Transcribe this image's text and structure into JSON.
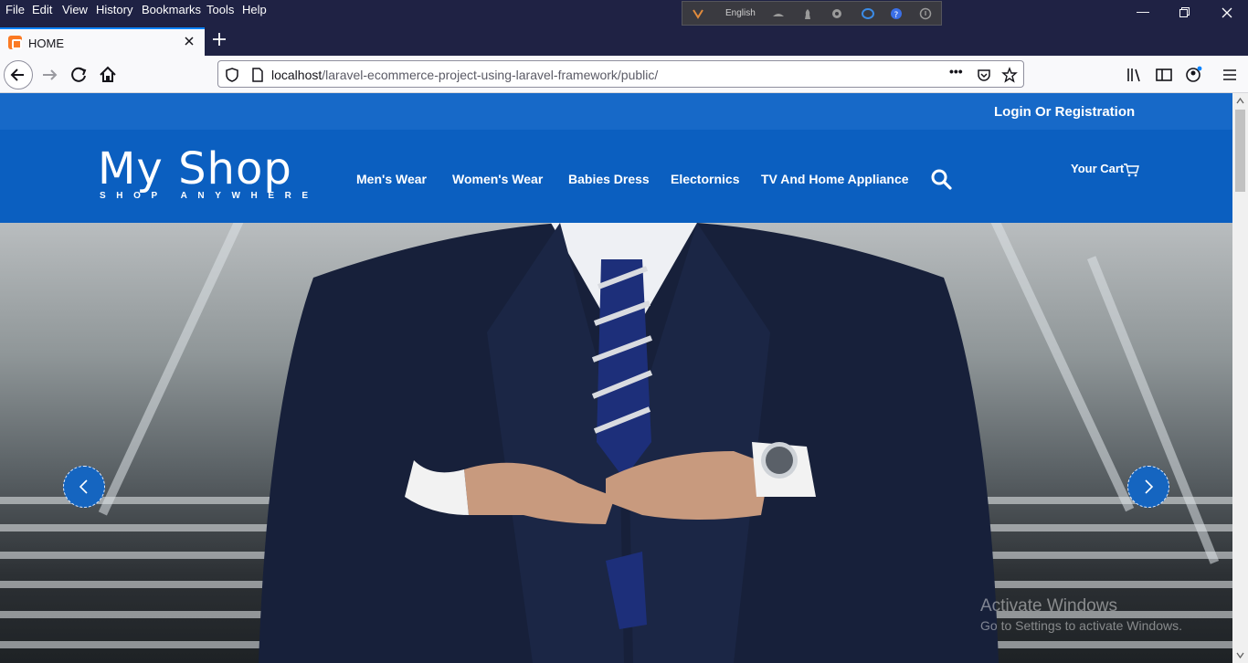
{
  "browser": {
    "menu": [
      "File",
      "Edit",
      "View",
      "History",
      "Bookmarks",
      "Tools",
      "Help"
    ],
    "extension_language": "English",
    "tab_title": "HOME",
    "url_host": "localhost",
    "url_path": "/laravel-ecommerce-project-using-laravel-framework/public/",
    "url_actions_glyph": "•••"
  },
  "site": {
    "login_link": "Login Or Registration",
    "logo_main": "My Shop",
    "logo_tagline": "SHOP ANYWHERE",
    "nav": [
      "Men's Wear",
      "Women's Wear",
      "Babies Dress",
      "Electornics",
      "TV And Home Appliance"
    ],
    "cart_label": "Your Cart",
    "colors": {
      "topbar": "#1769c8",
      "mainnav": "#0b5fc0",
      "arrow": "#1565c0"
    }
  },
  "os": {
    "activation_title": "Activate Windows",
    "activation_sub": "Go to Settings to activate Windows."
  }
}
